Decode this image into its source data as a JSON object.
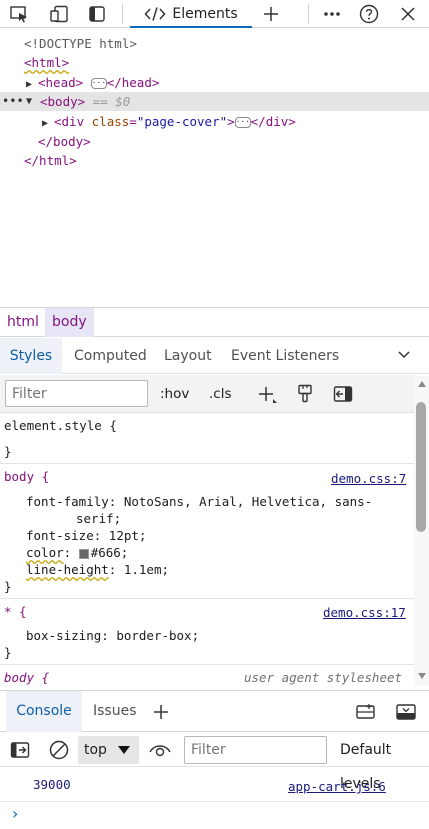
{
  "toolbar": {
    "tab_elements": "Elements",
    "icons": [
      "inspect-icon",
      "device-emulation-icon",
      "dock-icon",
      "code-icon",
      "add-tab-icon",
      "more-icon",
      "help-icon",
      "close-icon"
    ]
  },
  "dom": {
    "doctype": "<!DOCTYPE html>",
    "html_open": "<html>",
    "head_open": "<head>",
    "head_close": "</head>",
    "body_open": "<body>",
    "body_eq": "== $0",
    "div_open_prefix": "<div ",
    "div_attr_name": "class",
    "div_attr_eq": "=",
    "div_attr_value": "\"page-cover\"",
    "div_open_suffix": ">",
    "div_close": "</div>",
    "body_close": "</body>",
    "html_close": "</html>",
    "ellipsis": "···"
  },
  "breadcrumb": {
    "items": [
      "html",
      "body"
    ]
  },
  "styles_tabs": [
    "Styles",
    "Computed",
    "Layout",
    "Event Listeners"
  ],
  "filterbar": {
    "placeholder": "Filter",
    "hov": ":hov",
    "cls": ".cls"
  },
  "styles": {
    "element_style": "element.style {",
    "close_brace": "}",
    "rule1": {
      "selector": "body {",
      "source": "demo.css:7",
      "props": [
        {
          "name": "font-family",
          "value": "NotoSans, Arial, Helvetica, sans-",
          "value_cont": "serif;"
        },
        {
          "name": "font-size",
          "value": "12pt;"
        },
        {
          "name": "color",
          "value": "#666;"
        },
        {
          "name": "line-height",
          "value": "1.1em;"
        }
      ]
    },
    "rule2": {
      "selector": "* {",
      "source": "demo.css:17",
      "props": [
        {
          "name": "box-sizing",
          "value": "border-box;"
        }
      ]
    },
    "rule3": {
      "selector": "body {",
      "source": "user agent stylesheet"
    },
    "colors": {
      "tag": "#881280",
      "link": "#1a1a7a",
      "swatch": "#666666"
    }
  },
  "drawer": {
    "tabs": [
      "Console",
      "Issues"
    ],
    "context": "top",
    "filter_placeholder": "Filter",
    "levels": "Default levels"
  },
  "console": {
    "message": "39000",
    "source": "app-cart.js:6",
    "prompt": "›"
  }
}
